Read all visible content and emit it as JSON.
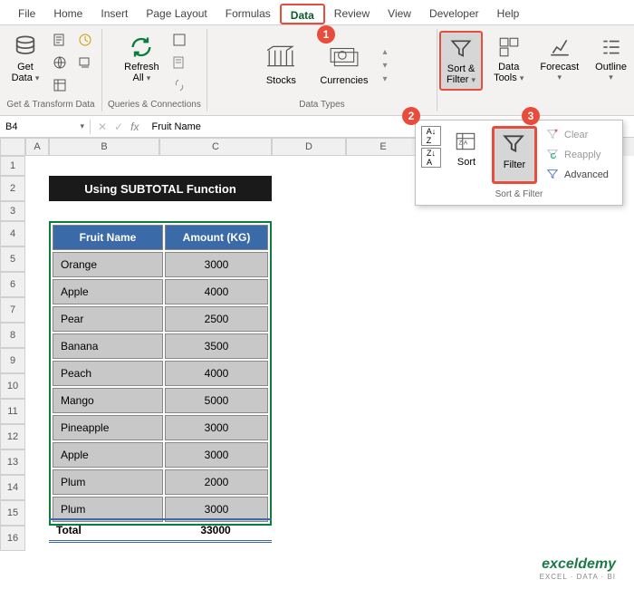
{
  "tabs": [
    "File",
    "Home",
    "Insert",
    "Page Layout",
    "Formulas",
    "Data",
    "Review",
    "View",
    "Developer",
    "Help"
  ],
  "active_tab_index": 5,
  "ribbon": {
    "group_transform": "Get & Transform Data",
    "get_data": "Get\nData",
    "group_queries": "Queries & Connections",
    "refresh_all": "Refresh\nAll",
    "group_datatypes": "Data Types",
    "stocks": "Stocks",
    "currencies": "Currencies",
    "sort_filter": "Sort &\nFilter",
    "data_tools": "Data\nTools",
    "forecast": "Forecast",
    "outline": "Outline"
  },
  "dropdown": {
    "sort": "Sort",
    "filter": "Filter",
    "clear": "Clear",
    "reapply": "Reapply",
    "advanced": "Advanced",
    "group_label": "Sort & Filter"
  },
  "callouts": {
    "c1": "1",
    "c2": "2",
    "c3": "3"
  },
  "name_box": "B4",
  "formula_value": "Fruit Name",
  "columns": [
    "A",
    "B",
    "C",
    "D",
    "E"
  ],
  "rows": [
    "1",
    "2",
    "3",
    "4",
    "5",
    "6",
    "7",
    "8",
    "9",
    "10",
    "11",
    "12",
    "13",
    "14",
    "15",
    "16"
  ],
  "title_cell": "Using SUBTOTAL Function",
  "table": {
    "headers": [
      "Fruit Name",
      "Amount (KG)"
    ],
    "rows": [
      [
        "Orange",
        "3000"
      ],
      [
        "Apple",
        "4000"
      ],
      [
        "Pear",
        "2500"
      ],
      [
        "Banana",
        "3500"
      ],
      [
        "Peach",
        "4000"
      ],
      [
        "Mango",
        "5000"
      ],
      [
        "Pineapple",
        "3000"
      ],
      [
        "Apple",
        "3000"
      ],
      [
        "Plum",
        "2000"
      ],
      [
        "Plum",
        "3000"
      ]
    ]
  },
  "total": {
    "label": "Total",
    "value": "33000"
  },
  "watermark": {
    "brand": "exceldemy",
    "tag": "EXCEL · DATA · BI"
  }
}
